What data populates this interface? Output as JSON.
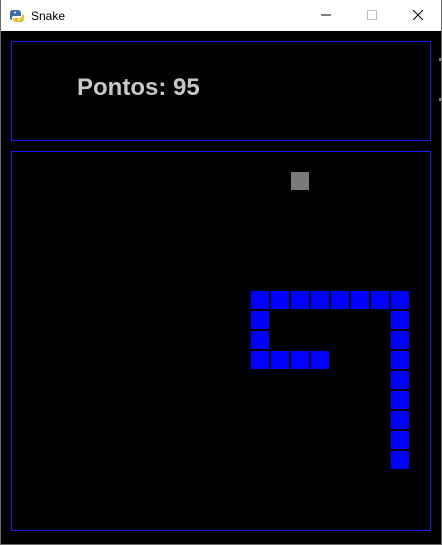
{
  "window": {
    "title": "Snake",
    "icon": "python-snake-icon",
    "controls": [
      "minimize",
      "maximize",
      "close"
    ]
  },
  "score": {
    "label": "Pontos:",
    "value": 95,
    "display": "Pontos: 95"
  },
  "game": {
    "grid_unit": "cell",
    "snake_color": "#0000ff",
    "food_color": "#7a7a7a",
    "border_color": "#1a1aff",
    "snake_length": 18,
    "snake": [
      [
        16,
        7
      ],
      [
        15,
        7
      ],
      [
        14,
        7
      ],
      [
        12,
        7
      ],
      [
        12,
        6
      ],
      [
        12,
        5
      ],
      [
        12,
        4
      ],
      [
        13,
        4
      ],
      [
        14,
        4
      ],
      [
        15,
        4
      ],
      [
        16,
        4
      ],
      [
        17,
        4
      ],
      [
        18,
        4
      ],
      [
        19,
        4
      ],
      [
        19,
        5
      ],
      [
        19,
        6
      ],
      [
        19,
        7
      ],
      [
        19,
        8
      ],
      [
        19,
        9
      ],
      [
        19,
        10
      ],
      [
        19,
        11
      ],
      [
        19,
        12
      ],
      [
        19,
        13
      ],
      [
        19,
        14
      ]
    ],
    "food": [
      14,
      -1
    ]
  }
}
